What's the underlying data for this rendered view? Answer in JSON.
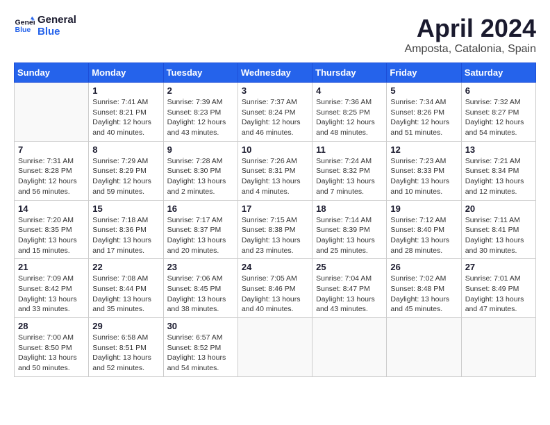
{
  "header": {
    "logo_line1": "General",
    "logo_line2": "Blue",
    "month_year": "April 2024",
    "location": "Amposta, Catalonia, Spain"
  },
  "days_of_week": [
    "Sunday",
    "Monday",
    "Tuesday",
    "Wednesday",
    "Thursday",
    "Friday",
    "Saturday"
  ],
  "weeks": [
    [
      {
        "day": "",
        "info": ""
      },
      {
        "day": "1",
        "info": "Sunrise: 7:41 AM\nSunset: 8:21 PM\nDaylight: 12 hours\nand 40 minutes."
      },
      {
        "day": "2",
        "info": "Sunrise: 7:39 AM\nSunset: 8:23 PM\nDaylight: 12 hours\nand 43 minutes."
      },
      {
        "day": "3",
        "info": "Sunrise: 7:37 AM\nSunset: 8:24 PM\nDaylight: 12 hours\nand 46 minutes."
      },
      {
        "day": "4",
        "info": "Sunrise: 7:36 AM\nSunset: 8:25 PM\nDaylight: 12 hours\nand 48 minutes."
      },
      {
        "day": "5",
        "info": "Sunrise: 7:34 AM\nSunset: 8:26 PM\nDaylight: 12 hours\nand 51 minutes."
      },
      {
        "day": "6",
        "info": "Sunrise: 7:32 AM\nSunset: 8:27 PM\nDaylight: 12 hours\nand 54 minutes."
      }
    ],
    [
      {
        "day": "7",
        "info": "Sunrise: 7:31 AM\nSunset: 8:28 PM\nDaylight: 12 hours\nand 56 minutes."
      },
      {
        "day": "8",
        "info": "Sunrise: 7:29 AM\nSunset: 8:29 PM\nDaylight: 12 hours\nand 59 minutes."
      },
      {
        "day": "9",
        "info": "Sunrise: 7:28 AM\nSunset: 8:30 PM\nDaylight: 13 hours\nand 2 minutes."
      },
      {
        "day": "10",
        "info": "Sunrise: 7:26 AM\nSunset: 8:31 PM\nDaylight: 13 hours\nand 4 minutes."
      },
      {
        "day": "11",
        "info": "Sunrise: 7:24 AM\nSunset: 8:32 PM\nDaylight: 13 hours\nand 7 minutes."
      },
      {
        "day": "12",
        "info": "Sunrise: 7:23 AM\nSunset: 8:33 PM\nDaylight: 13 hours\nand 10 minutes."
      },
      {
        "day": "13",
        "info": "Sunrise: 7:21 AM\nSunset: 8:34 PM\nDaylight: 13 hours\nand 12 minutes."
      }
    ],
    [
      {
        "day": "14",
        "info": "Sunrise: 7:20 AM\nSunset: 8:35 PM\nDaylight: 13 hours\nand 15 minutes."
      },
      {
        "day": "15",
        "info": "Sunrise: 7:18 AM\nSunset: 8:36 PM\nDaylight: 13 hours\nand 17 minutes."
      },
      {
        "day": "16",
        "info": "Sunrise: 7:17 AM\nSunset: 8:37 PM\nDaylight: 13 hours\nand 20 minutes."
      },
      {
        "day": "17",
        "info": "Sunrise: 7:15 AM\nSunset: 8:38 PM\nDaylight: 13 hours\nand 23 minutes."
      },
      {
        "day": "18",
        "info": "Sunrise: 7:14 AM\nSunset: 8:39 PM\nDaylight: 13 hours\nand 25 minutes."
      },
      {
        "day": "19",
        "info": "Sunrise: 7:12 AM\nSunset: 8:40 PM\nDaylight: 13 hours\nand 28 minutes."
      },
      {
        "day": "20",
        "info": "Sunrise: 7:11 AM\nSunset: 8:41 PM\nDaylight: 13 hours\nand 30 minutes."
      }
    ],
    [
      {
        "day": "21",
        "info": "Sunrise: 7:09 AM\nSunset: 8:42 PM\nDaylight: 13 hours\nand 33 minutes."
      },
      {
        "day": "22",
        "info": "Sunrise: 7:08 AM\nSunset: 8:44 PM\nDaylight: 13 hours\nand 35 minutes."
      },
      {
        "day": "23",
        "info": "Sunrise: 7:06 AM\nSunset: 8:45 PM\nDaylight: 13 hours\nand 38 minutes."
      },
      {
        "day": "24",
        "info": "Sunrise: 7:05 AM\nSunset: 8:46 PM\nDaylight: 13 hours\nand 40 minutes."
      },
      {
        "day": "25",
        "info": "Sunrise: 7:04 AM\nSunset: 8:47 PM\nDaylight: 13 hours\nand 43 minutes."
      },
      {
        "day": "26",
        "info": "Sunrise: 7:02 AM\nSunset: 8:48 PM\nDaylight: 13 hours\nand 45 minutes."
      },
      {
        "day": "27",
        "info": "Sunrise: 7:01 AM\nSunset: 8:49 PM\nDaylight: 13 hours\nand 47 minutes."
      }
    ],
    [
      {
        "day": "28",
        "info": "Sunrise: 7:00 AM\nSunset: 8:50 PM\nDaylight: 13 hours\nand 50 minutes."
      },
      {
        "day": "29",
        "info": "Sunrise: 6:58 AM\nSunset: 8:51 PM\nDaylight: 13 hours\nand 52 minutes."
      },
      {
        "day": "30",
        "info": "Sunrise: 6:57 AM\nSunset: 8:52 PM\nDaylight: 13 hours\nand 54 minutes."
      },
      {
        "day": "",
        "info": ""
      },
      {
        "day": "",
        "info": ""
      },
      {
        "day": "",
        "info": ""
      },
      {
        "day": "",
        "info": ""
      }
    ]
  ]
}
